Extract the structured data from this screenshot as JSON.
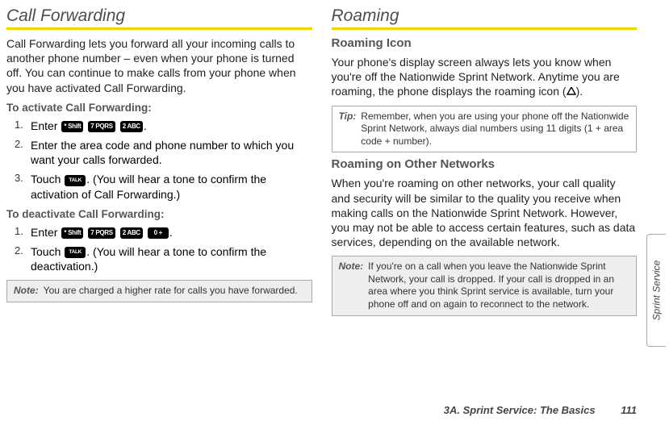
{
  "left": {
    "title": "Call Forwarding",
    "intro": "Call Forwarding lets you forward all your incoming calls to another phone number – even when your phone is turned off. You can continue to make calls from your phone when you have activated Call Forwarding.",
    "activate_head": "To activate Call Forwarding:",
    "act_step1_a": "Enter ",
    "act_step1_b": ".",
    "act_step2": "Enter the area code and phone number to which you want your calls forwarded.",
    "act_step3_a": "Touch ",
    "act_step3_b": ". (You will hear a tone to confirm the activation of Call Forwarding.)",
    "deactivate_head": "To deactivate Call Forwarding:",
    "de_step1_a": "Enter ",
    "de_step1_b": ".",
    "de_step2_a": "Touch ",
    "de_step2_b": ". (You will hear a tone to confirm the deactivation.)",
    "note_label": "Note:",
    "note_text": "You are charged a higher rate for calls you have forwarded."
  },
  "right": {
    "title": "Roaming",
    "icon_head": "Roaming Icon",
    "icon_para": "Your phone's display screen always lets you know when you're off the Nationwide Sprint Network. Anytime you are roaming, the phone displays the roaming icon (",
    "icon_para_b": ").",
    "tip_label": "Tip:",
    "tip_text": "Remember, when you are using your phone off the Nationwide Sprint Network, always dial numbers using 11 digits (1 + area code + number).",
    "other_head": "Roaming on Other Networks",
    "other_para": "When you're roaming on other networks, your call quality and security will be similar to the quality you receive when making calls on the Nationwide Sprint Network. However, you may not be able to access certain features, such as data services, depending on the available network.",
    "note_label": "Note:",
    "note_text": "If you're on a call when you leave the Nationwide Sprint Network, your call is dropped. If your call is dropped in an area where you think Sprint service is available, turn your phone off and on again to reconnect to the network."
  },
  "keys": {
    "star": "* Shift",
    "seven": "7 PQRS",
    "two": "2 ABC",
    "zero": "0 +",
    "talk": "TALK"
  },
  "side_tab": "Sprint Service",
  "footer": {
    "chapter": "3A. Sprint Service: The Basics",
    "page": "111"
  }
}
